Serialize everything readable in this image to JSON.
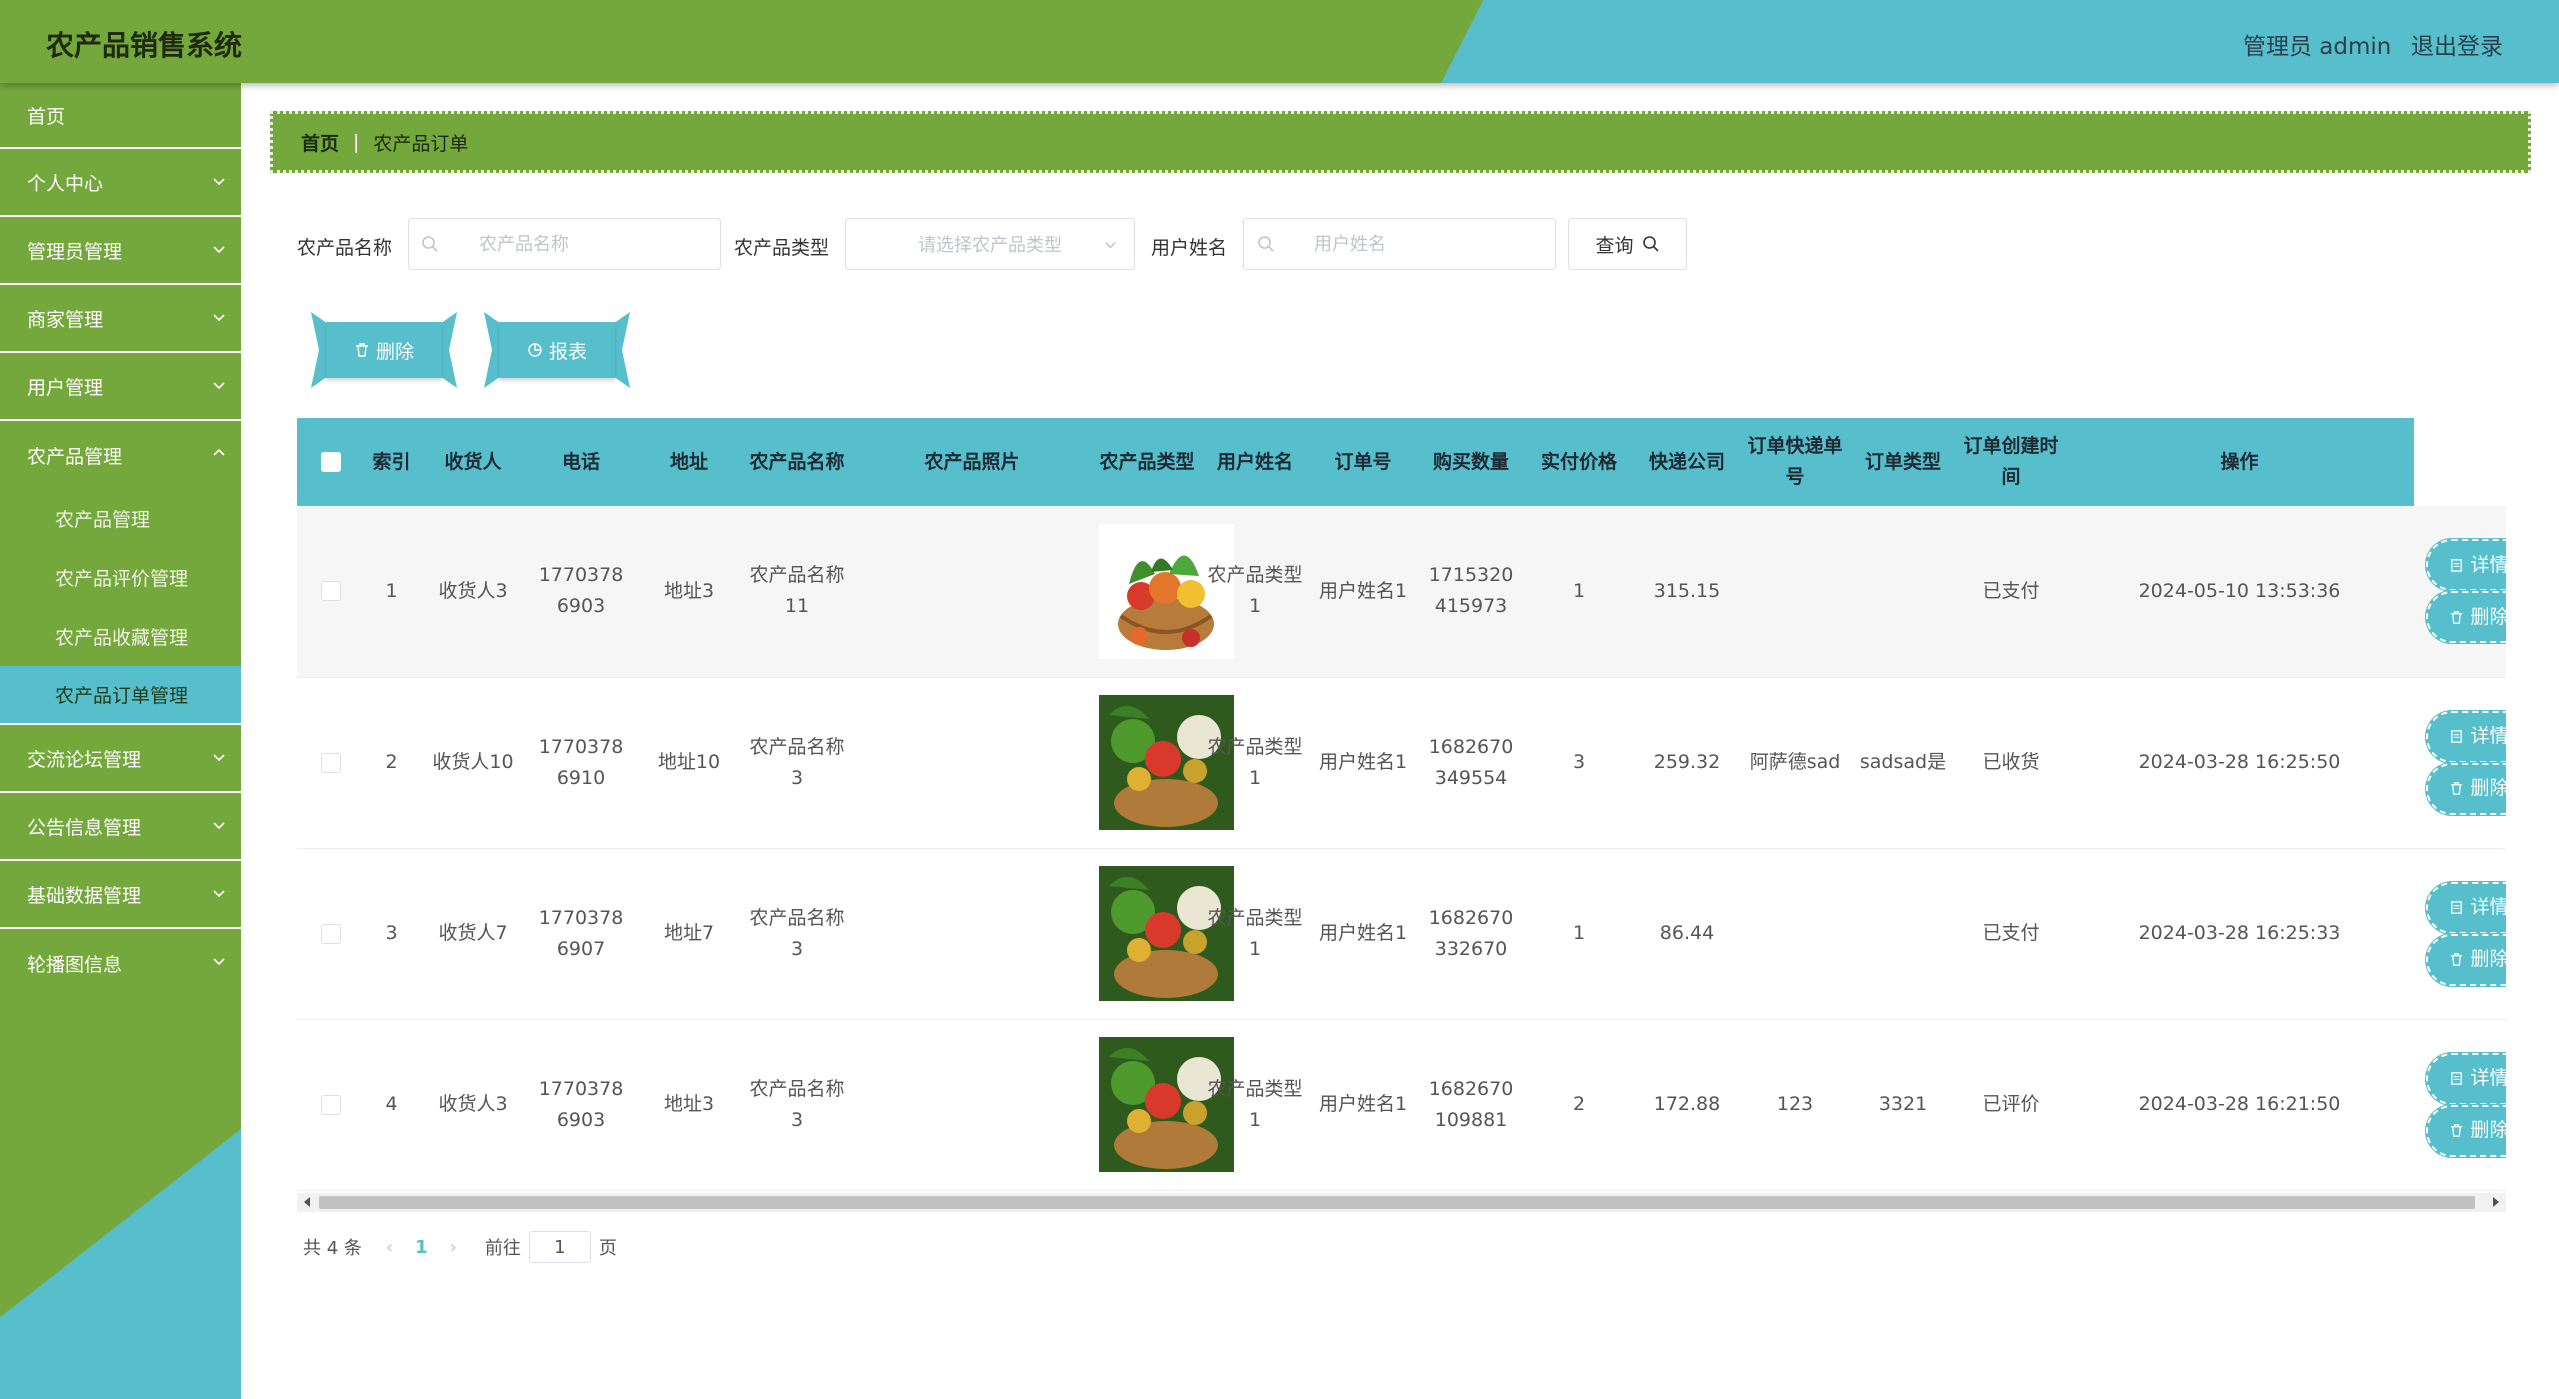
{
  "header": {
    "app_title": "农产品销售系统",
    "user_label": "管理员 admin",
    "logout_label": "退出登录"
  },
  "sidebar": {
    "items": [
      {
        "label": "首页"
      },
      {
        "label": "个人中心"
      },
      {
        "label": "管理员管理"
      },
      {
        "label": "商家管理"
      },
      {
        "label": "用户管理"
      },
      {
        "label": "农产品管理"
      },
      {
        "label": "交流论坛管理"
      },
      {
        "label": "公告信息管理"
      },
      {
        "label": "基础数据管理"
      },
      {
        "label": "轮播图信息"
      }
    ],
    "submenu": [
      {
        "label": "农产品管理"
      },
      {
        "label": "农产品评价管理"
      },
      {
        "label": "农产品收藏管理"
      },
      {
        "label": "农产品订单管理"
      }
    ]
  },
  "breadcrumb": {
    "home": "首页",
    "current": "农产品订单"
  },
  "search": {
    "name_label": "农产品名称",
    "name_placeholder": "农产品名称",
    "type_label": "农产品类型",
    "type_placeholder": "请选择农产品类型",
    "user_label": "用户姓名",
    "user_placeholder": "用户姓名",
    "query_label": "查询"
  },
  "actions": {
    "delete_label": "删除",
    "report_label": "报表"
  },
  "table": {
    "headers": [
      "索引",
      "收货人",
      "电话",
      "地址",
      "农产品名称",
      "农产品照片",
      "农产品类型",
      "用户姓名",
      "订单号",
      "购买数量",
      "实付价格",
      "快递公司",
      "订单快递单号",
      "订单类型",
      "订单创建时间",
      "操作"
    ],
    "detail_label": "详情",
    "delete_label": "删除",
    "rows": [
      {
        "index": "1",
        "receiver": "收货人3",
        "phone": "17703786903",
        "address": "地址3",
        "product": "农产品名称11",
        "photo": "vegetable-basket-photo",
        "type": "农产品类型1",
        "user": "用户姓名1",
        "order_no": "1715320415973",
        "qty": "1",
        "price": "315.15",
        "courier": "",
        "tracking": "",
        "status": "已支付",
        "created": "2024-05-10 13:53:36"
      },
      {
        "index": "2",
        "receiver": "收货人10",
        "phone": "17703786910",
        "address": "地址10",
        "product": "农产品名称3",
        "photo": "vegetable-basket-photo",
        "type": "农产品类型1",
        "user": "用户姓名1",
        "order_no": "1682670349554",
        "qty": "3",
        "price": "259.32",
        "courier": "阿萨德sad",
        "tracking": "sadsad是",
        "status": "已收货",
        "created": "2024-03-28 16:25:50"
      },
      {
        "index": "3",
        "receiver": "收货人7",
        "phone": "17703786907",
        "address": "地址7",
        "product": "农产品名称3",
        "photo": "vegetable-basket-photo",
        "type": "农产品类型1",
        "user": "用户姓名1",
        "order_no": "1682670332670",
        "qty": "1",
        "price": "86.44",
        "courier": "",
        "tracking": "",
        "status": "已支付",
        "created": "2024-03-28 16:25:33"
      },
      {
        "index": "4",
        "receiver": "收货人3",
        "phone": "17703786903",
        "address": "地址3",
        "product": "农产品名称3",
        "photo": "vegetable-basket-photo",
        "type": "农产品类型1",
        "user": "用户姓名1",
        "order_no": "1682670109881",
        "qty": "2",
        "price": "172.88",
        "courier": "123",
        "tracking": "3321",
        "status": "已评价",
        "created": "2024-03-28 16:21:50"
      }
    ]
  },
  "pagination": {
    "total_label": "共 4 条",
    "current_page": "1",
    "goto_prefix": "前往",
    "goto_value": "1",
    "goto_suffix": "页"
  },
  "colors": {
    "green": "#74a73c",
    "teal": "#56bfcb"
  }
}
